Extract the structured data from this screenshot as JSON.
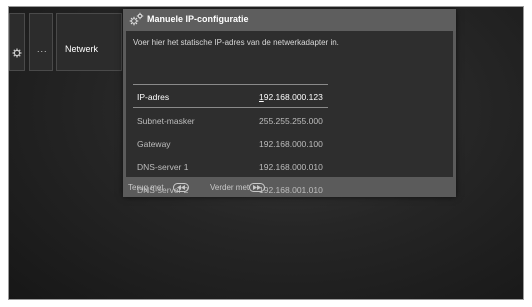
{
  "menu": {
    "settings_icon": "gear-icon",
    "dots_label": "...",
    "network_label": "Netwerk"
  },
  "dialog": {
    "icon": "gears-icon",
    "title": "Manuele IP-configuratie",
    "instruction": "Voer hier het statische IP-adres van de netwerkadapter in.",
    "fields": [
      {
        "label": "IP-adres",
        "value_first": "1",
        "value_rest": "92.168.000.123"
      },
      {
        "label": "Subnet-masker",
        "value": "255.255.255.000"
      },
      {
        "label": "Gateway",
        "value": "192.168.000.100"
      },
      {
        "label": "DNS-server 1",
        "value": "192.168.000.010"
      },
      {
        "label": "DNS-server 2",
        "value": "192.168.001.010"
      }
    ],
    "footer": {
      "back_label": "Terug met",
      "back_icon": "rewind-button-icon",
      "next_label": "Verder met",
      "next_icon": "fast-forward-button-icon"
    }
  },
  "colors": {
    "background": "#1e1e1e",
    "dialog_frame": "#5b5b5b",
    "dialog_body": "#2e2e2e",
    "text_active": "#ffffff",
    "text_inactive": "#bdbdbd"
  }
}
